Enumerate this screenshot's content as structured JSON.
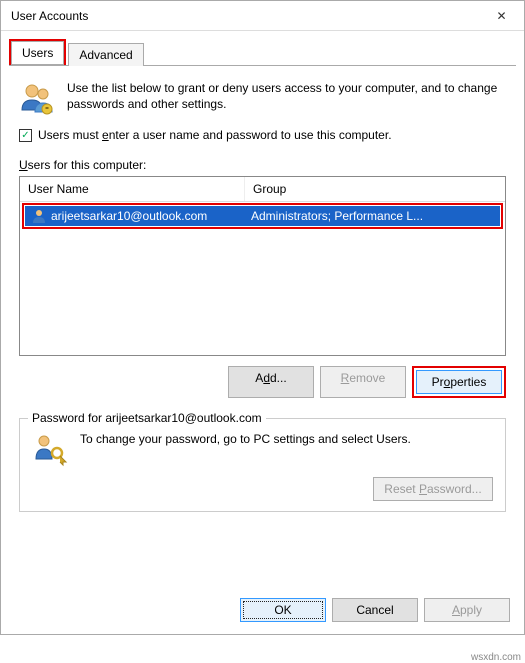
{
  "window": {
    "title": "User Accounts"
  },
  "tabs": {
    "users": "Users",
    "advanced": "Advanced"
  },
  "intro": "Use the list below to grant or deny users access to your computer, and to change passwords and other settings.",
  "checkbox": {
    "checked": true,
    "label_pre": "Users must ",
    "label_u": "e",
    "label_post": "nter a user name and password to use this computer."
  },
  "list": {
    "label_u": "U",
    "label_post": "sers for this computer:",
    "col_username": "User Name",
    "col_group": "Group",
    "rows": [
      {
        "username": "arijeetsarkar10@outlook.com",
        "group": "Administrators; Performance L..."
      }
    ]
  },
  "buttons": {
    "add_pre": "A",
    "add_u": "d",
    "add_post": "d...",
    "remove_u": "R",
    "remove_post": "emove",
    "properties_pre": "Pr",
    "properties_u": "o",
    "properties_post": "perties",
    "reset_pre": "Reset ",
    "reset_u": "P",
    "reset_post": "assword...",
    "ok": "OK",
    "cancel": "Cancel",
    "apply_u": "A",
    "apply_post": "pply"
  },
  "password_box": {
    "title": "Password for arijeetsarkar10@outlook.com",
    "text": "To change your password, go to PC settings and select Users."
  },
  "watermark": "wsxdn.com"
}
